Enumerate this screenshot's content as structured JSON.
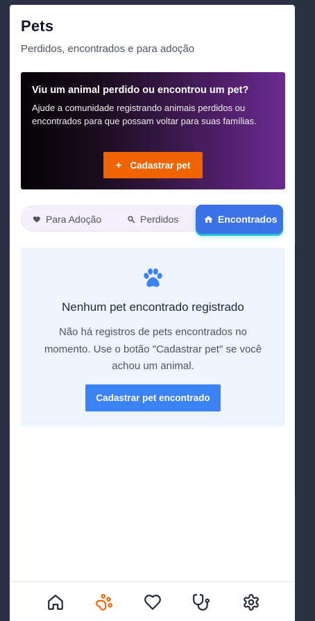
{
  "header": {
    "title": "Pets",
    "subtitle": "Perdidos, encontrados e para adoção"
  },
  "banner": {
    "title": "Viu um animal perdido ou encontrou um pet?",
    "text": "Ajude a comunidade registrando animais perdidos ou encontrados para que possam voltar para suas famílias.",
    "button_label": "Cadastrar pet",
    "button_icon": "plus-icon",
    "button_color": "#f06400"
  },
  "tabs": [
    {
      "label": "Para Adoção",
      "icon": "heart-icon",
      "active": false
    },
    {
      "label": "Perdidos",
      "icon": "search-icon",
      "active": false
    },
    {
      "label": "Encontrados",
      "icon": "home-icon",
      "active": true
    }
  ],
  "empty_state": {
    "icon": "paw-icon",
    "title": "Nenhum pet encontrado registrado",
    "text": "Não há registros de pets encontrados no momento. Use o botão \"Cadastrar pet\" se você achou um animal.",
    "button_label": "Cadastrar pet encontrado"
  },
  "bottom_nav": [
    {
      "icon": "home-icon",
      "active": false
    },
    {
      "icon": "paw-icon",
      "active": true
    },
    {
      "icon": "heart-icon",
      "active": false
    },
    {
      "icon": "stethoscope-icon",
      "active": false
    },
    {
      "icon": "gear-icon",
      "active": false
    }
  ],
  "colors": {
    "accent": "#3b82f6",
    "active_tab": "#3b72e8",
    "nav_active": "#f06400",
    "background": "#2a3142"
  }
}
